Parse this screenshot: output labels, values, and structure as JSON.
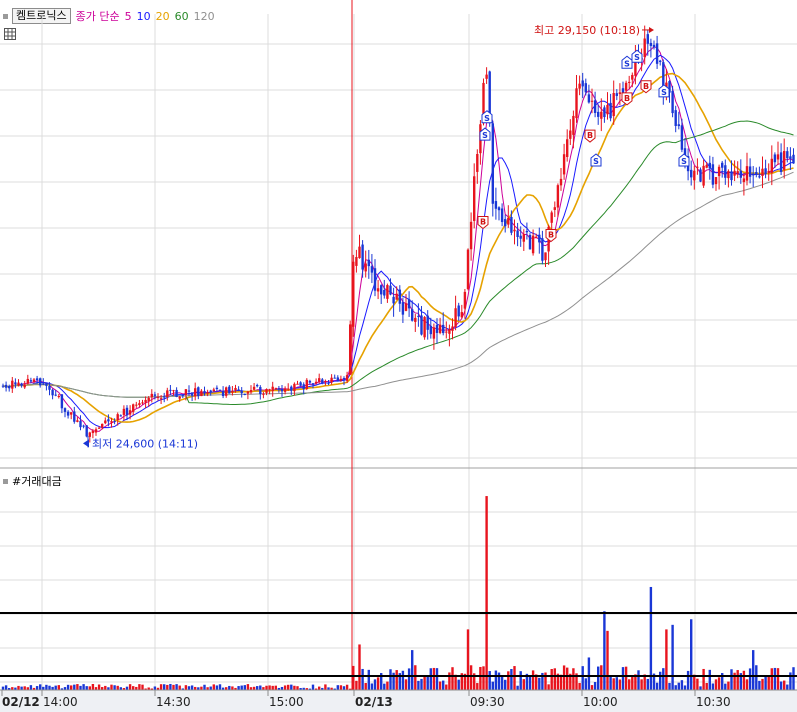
{
  "legend": {
    "stock_name": "켐트로닉스",
    "ma_label": "종가 단순",
    "periods": [
      {
        "label": "5",
        "color": "#cc0099"
      },
      {
        "label": "10",
        "color": "#1a1aff"
      },
      {
        "label": "20",
        "color": "#e6a200"
      },
      {
        "label": "60",
        "color": "#2a8a2a"
      },
      {
        "label": "120",
        "color": "#909090"
      }
    ]
  },
  "annotations": {
    "high": "최고 29,150 (10:18)",
    "low": "최저 24,600 (14:11)"
  },
  "volume_title": "#거래대금",
  "x_labels": [
    "02/12",
    "14:00",
    "14:30",
    "15:00",
    "02/13",
    "09:30",
    "10:00",
    "10:30"
  ],
  "signals": [
    "B",
    "S"
  ],
  "colors": {
    "up": "#e8141e",
    "down": "#1a37d6",
    "grid": "#dcdcdc",
    "day_divider": "#e8141e"
  },
  "chart_data": [
    {
      "type": "candlestick",
      "title": "켐트로닉스",
      "ylim": [
        24200,
        29450
      ],
      "x": [
        "02/12",
        "14:00",
        "14:30",
        "15:00",
        "02/13",
        "09:30",
        "10:00",
        "10:30"
      ],
      "keypoints": [
        {
          "x": "02/12 13:40",
          "price": 25150
        },
        {
          "x": "14:00",
          "price": 25200
        },
        {
          "x": "14:11",
          "price": 24600
        },
        {
          "x": "14:30",
          "price": 25050
        },
        {
          "x": "15:00",
          "price": 25100
        },
        {
          "x": "15:30",
          "price": 25250
        },
        {
          "x": "02/13 09:01",
          "price": 26800
        },
        {
          "x": "09:10",
          "price": 26300
        },
        {
          "x": "09:20",
          "price": 25800
        },
        {
          "x": "09:28",
          "price": 25950
        },
        {
          "x": "09:33",
          "price": 28900
        },
        {
          "x": "09:37",
          "price": 27100
        },
        {
          "x": "09:50",
          "price": 26700
        },
        {
          "x": "09:55",
          "price": 28700
        },
        {
          "x": "10:05",
          "price": 28200
        },
        {
          "x": "10:18",
          "price": 29150
        },
        {
          "x": "10:25",
          "price": 28600
        },
        {
          "x": "10:32",
          "price": 27600
        },
        {
          "x": "10:40",
          "price": 27600
        },
        {
          "x": "10:45",
          "price": 27800
        }
      ],
      "high": {
        "value": 29150,
        "time": "10:18"
      },
      "low": {
        "value": 24600,
        "time": "14:11"
      },
      "series": [
        {
          "name": "5",
          "type": "line"
        },
        {
          "name": "10",
          "type": "line"
        },
        {
          "name": "20",
          "type": "line"
        },
        {
          "name": "60",
          "type": "line"
        },
        {
          "name": "120",
          "type": "line"
        }
      ]
    },
    {
      "type": "bar",
      "title": "#거래대금",
      "x": [
        "02/12 14:00",
        "15:00",
        "02/13 09:00",
        "09:01",
        "09:02",
        "09:30",
        "09:33",
        "09:34",
        "10:00",
        "10:05",
        "10:18",
        "10:25"
      ],
      "values": [
        0.5,
        0.7,
        20,
        10,
        6,
        10,
        32,
        16,
        15,
        13,
        17,
        10
      ],
      "ylim": [
        0,
        33
      ]
    }
  ]
}
